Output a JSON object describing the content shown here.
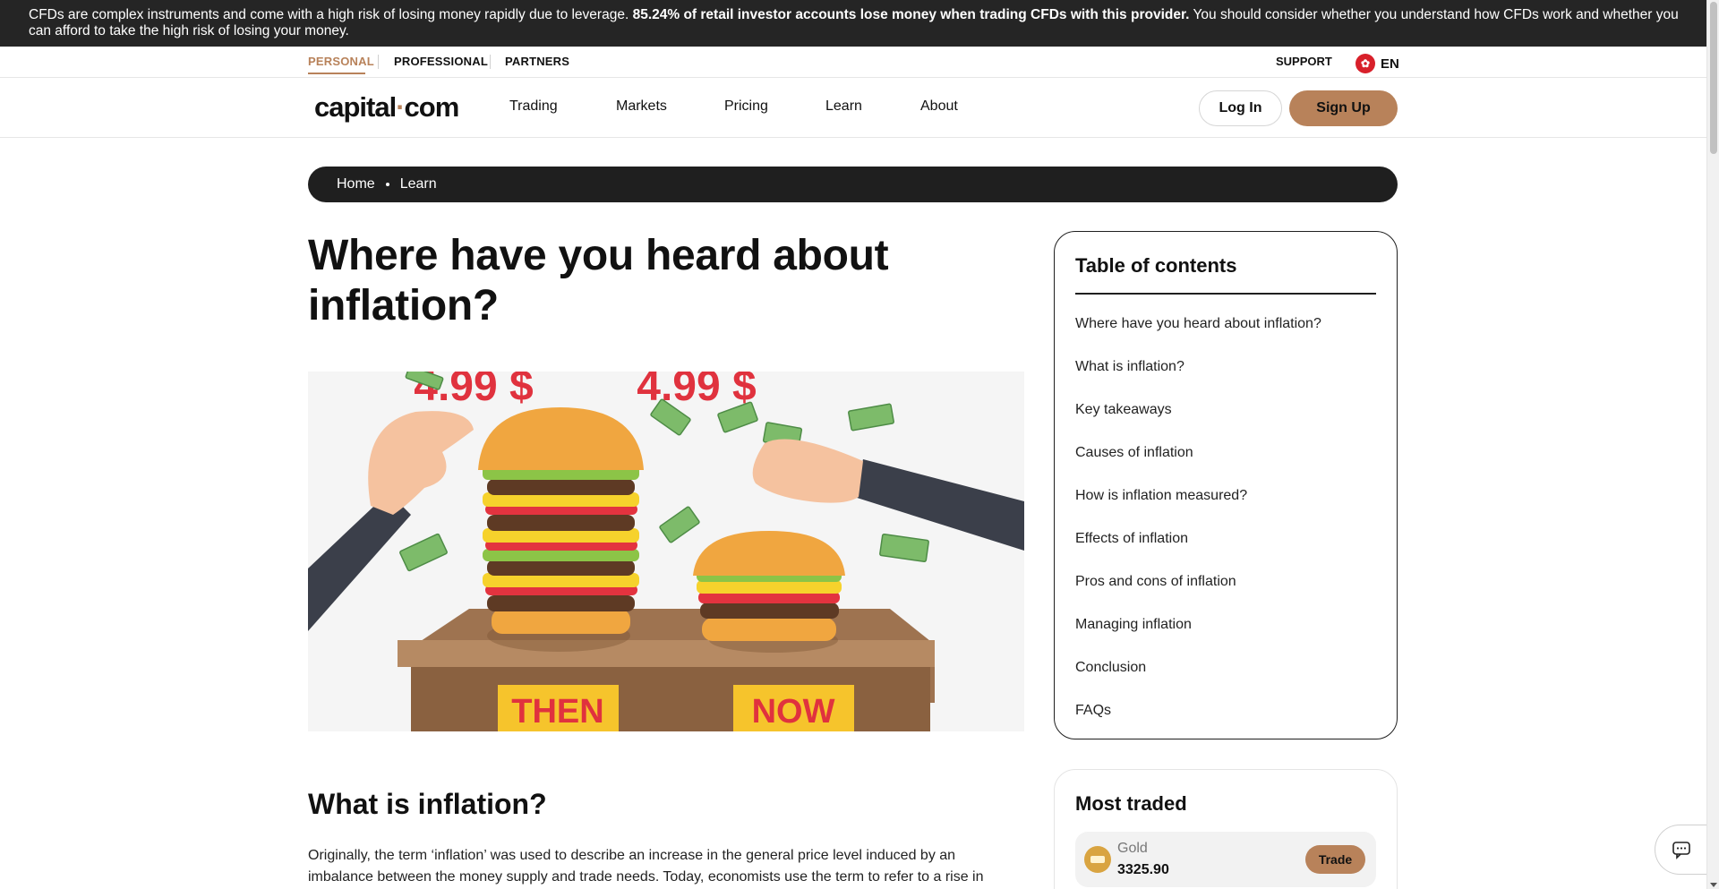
{
  "risk_banner": {
    "text_before": "CFDs are complex instruments and come with a high risk of losing money rapidly due to leverage.",
    "text_bold": "85.24% of retail investor accounts lose money when trading CFDs with this provider.",
    "text_after": "You should consider whether you understand how CFDs work and whether you can afford to take the high risk of losing your money."
  },
  "subnav": {
    "tabs": [
      "PERSONAL",
      "PROFESSIONAL",
      "PARTNERS"
    ],
    "support": "SUPPORT",
    "language": "EN"
  },
  "header": {
    "logo_left": "capital",
    "logo_dot": "·",
    "logo_right": "com",
    "menu": [
      "Trading",
      "Markets",
      "Pricing",
      "Learn",
      "About"
    ],
    "login": "Log In",
    "signup": "Sign Up"
  },
  "breadcrumb": [
    "Home",
    "Learn"
  ],
  "article": {
    "title": "Where have you heard about inflation?",
    "hero": {
      "price_then": "4.99 $",
      "price_now": "4.99 $",
      "label_then": "THEN",
      "label_now": "NOW"
    },
    "section_heading": "What is inflation?",
    "paragraph": "Originally, the term ‘inflation’ was used to describe an increase in the general price level induced by an imbalance between the money supply and trade needs. Today, economists use the term to refer to a rise in"
  },
  "toc": {
    "title": "Table of contents",
    "items": [
      "Where have you heard about inflation?",
      "What is inflation?",
      "Key takeaways",
      "Causes of inflation",
      "How is inflation measured?",
      "Effects of inflation",
      "Pros and cons of inflation",
      "Managing inflation",
      "Conclusion",
      "FAQs"
    ]
  },
  "most_traded": {
    "title": "Most traded",
    "items": [
      {
        "name": "Gold",
        "price": "3325.90",
        "action": "Trade"
      }
    ]
  },
  "icons": {
    "flag": "hong-kong-flag-icon",
    "chat": "chat-bubble-icon",
    "gold": "gold-bars-icon"
  },
  "colors": {
    "accent": "#b8825a",
    "dark": "#1f1f1f",
    "banner": "#252525"
  }
}
